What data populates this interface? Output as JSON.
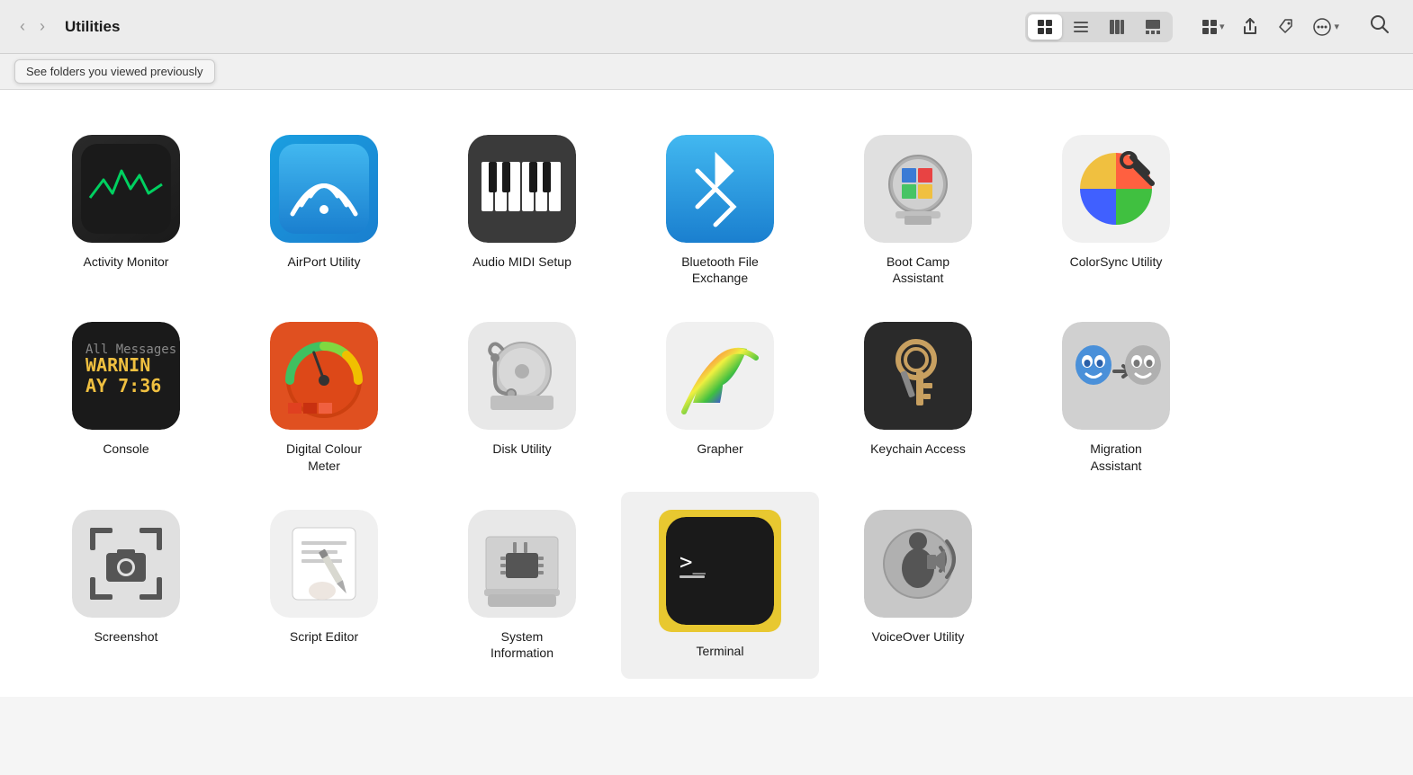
{
  "toolbar": {
    "title": "Utilities",
    "nav": {
      "back_label": "‹",
      "forward_label": "›"
    },
    "view_buttons": [
      {
        "id": "grid",
        "label": "⊞",
        "active": true
      },
      {
        "id": "list",
        "label": "☰",
        "active": false
      },
      {
        "id": "columns",
        "label": "⊟",
        "active": false
      },
      {
        "id": "gallery",
        "label": "⊡",
        "active": false
      }
    ],
    "action_buttons": [
      {
        "id": "group",
        "label": "⊞",
        "has_caret": true
      },
      {
        "id": "share",
        "label": "⬆"
      },
      {
        "id": "tag",
        "label": "◇"
      },
      {
        "id": "more",
        "label": "···",
        "has_caret": true
      }
    ],
    "search_label": "🔍"
  },
  "pathbar": {
    "breadcrumb_tooltip": "See folders you viewed previously"
  },
  "apps": [
    {
      "id": "activity-monitor",
      "label": "Activity Monitor"
    },
    {
      "id": "airport-utility",
      "label": "AirPort Utility"
    },
    {
      "id": "audio-midi-setup",
      "label": "Audio MIDI Setup"
    },
    {
      "id": "bluetooth-file-exchange",
      "label": "Bluetooth File\nExchange"
    },
    {
      "id": "boot-camp-assistant",
      "label": "Boot Camp\nAssistant"
    },
    {
      "id": "colorsync-utility",
      "label": "ColorSync Utility"
    },
    {
      "id": "console",
      "label": "Console"
    },
    {
      "id": "digital-colour-meter",
      "label": "Digital Colour\nMeter"
    },
    {
      "id": "disk-utility",
      "label": "Disk Utility"
    },
    {
      "id": "grapher",
      "label": "Grapher"
    },
    {
      "id": "keychain-access",
      "label": "Keychain Access"
    },
    {
      "id": "migration-assistant",
      "label": "Migration\nAssistant"
    },
    {
      "id": "screenshot",
      "label": "Screenshot"
    },
    {
      "id": "script-editor",
      "label": "Script Editor"
    },
    {
      "id": "system-information",
      "label": "System\nInformation"
    },
    {
      "id": "terminal",
      "label": "Terminal",
      "selected": true
    },
    {
      "id": "voiceover-utility",
      "label": "VoiceOver Utility"
    }
  ]
}
